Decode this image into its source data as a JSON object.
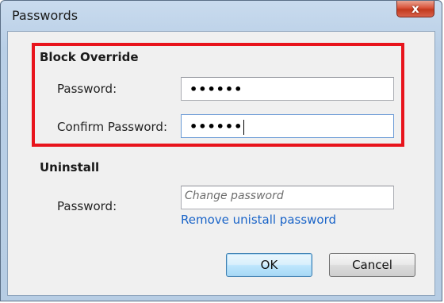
{
  "window": {
    "title": "Passwords",
    "close_glyph": "x"
  },
  "block_override": {
    "heading": "Block Override",
    "password_label": "Password:",
    "password_value": "••••••",
    "confirm_label": "Confirm Password:",
    "confirm_value": "••••••"
  },
  "uninstall": {
    "heading": "Uninstall",
    "password_label": "Password:",
    "password_placeholder": "Change password",
    "remove_link": "Remove unistall password"
  },
  "buttons": {
    "ok": "OK",
    "cancel": "Cancel"
  },
  "colors": {
    "highlight": "#e8141c",
    "link": "#1a64c8"
  }
}
